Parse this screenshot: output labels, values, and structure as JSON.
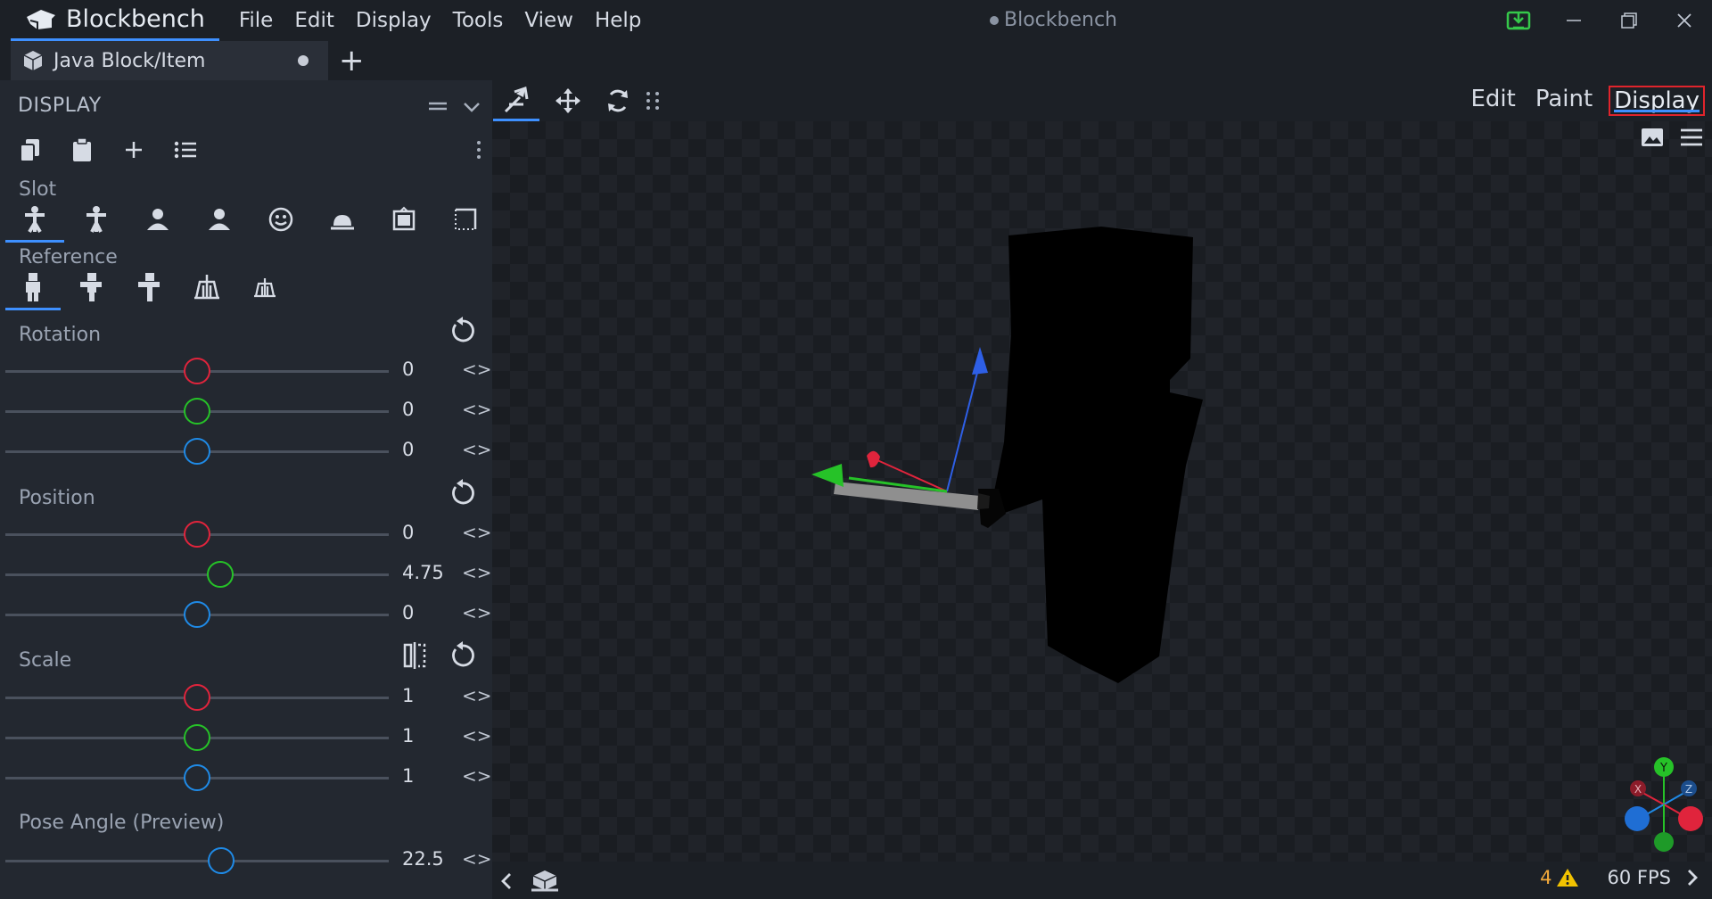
{
  "app": {
    "name": "Blockbench",
    "window_title": "Blockbench",
    "menu": [
      "File",
      "Edit",
      "Display",
      "Tools",
      "View",
      "Help"
    ]
  },
  "tabs": [
    {
      "label": "Java Block/Item",
      "unsaved": true
    }
  ],
  "panel": {
    "title": "DISPLAY",
    "slot_label": "Slot",
    "slots": [
      "thirdperson-righthand",
      "thirdperson-lefthand",
      "firstperson-righthand",
      "firstperson-lefthand",
      "head",
      "ground",
      "item-frame",
      "gui"
    ],
    "selected_slot": 0,
    "reference_label": "Reference",
    "references": [
      "player",
      "zombie",
      "armor-stand",
      "baby-armor-stand",
      "armor-stand-small"
    ],
    "selected_reference": 0
  },
  "rotation": {
    "label": "Rotation",
    "values": [
      "0",
      "0",
      "0"
    ],
    "fractions": [
      0.5,
      0.5,
      0.5
    ]
  },
  "position": {
    "label": "Position",
    "values": [
      "0",
      "4.75",
      "0"
    ],
    "fractions": [
      0.5,
      0.5594,
      0.5
    ]
  },
  "scale": {
    "label": "Scale",
    "values": [
      "1",
      "1",
      "1"
    ],
    "fractions": [
      0.5,
      0.5,
      0.5
    ]
  },
  "pose": {
    "label": "Pose Angle (Preview)",
    "value": "22.5",
    "fraction": 0.5625
  },
  "modes": [
    "Edit",
    "Paint",
    "Display"
  ],
  "active_mode": "Display",
  "status": {
    "warnings": "4",
    "fps": "60 FPS"
  },
  "colors": {
    "x_axis": "#e0243c",
    "y_axis": "#26c228",
    "z_axis": "#1f8ae6",
    "accent": "#3e90ff"
  }
}
